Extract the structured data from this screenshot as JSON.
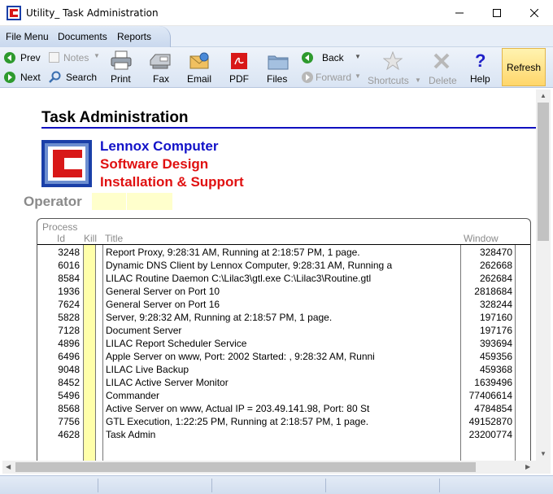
{
  "window": {
    "title": "Utility_ Task Administration"
  },
  "menu": {
    "items": [
      "File Menu",
      "Documents",
      "Reports"
    ]
  },
  "toolbar": {
    "prev": "Prev",
    "next": "Next",
    "notes": "Notes",
    "search": "Search",
    "print": "Print",
    "fax": "Fax",
    "email": "Email",
    "pdf": "PDF",
    "files": "Files",
    "back": "Back",
    "forward": "Forward",
    "shortcuts": "Shortcuts",
    "delete": "Delete",
    "help": "Help",
    "refresh": "Refresh"
  },
  "page": {
    "title": "Task Administration",
    "company": [
      "Lennox Computer",
      "Software Design",
      "Installation & Support"
    ],
    "operator_label": "Operator"
  },
  "grid": {
    "header_process": "Process",
    "header_id": "Id",
    "header_kill": "Kill",
    "header_title": "Title",
    "header_window": "Window",
    "rows": [
      {
        "id": "3248",
        "title": "Report Proxy, 9:28:31 AM, Running at 2:18:57 PM, 1 page.",
        "window": "328470"
      },
      {
        "id": "6016",
        "title": "Dynamic DNS Client by Lennox Computer, 9:28:31 AM, Running a",
        "window": "262668"
      },
      {
        "id": "8584",
        "title": "LILAC Routine Daemon C:\\Lilac3\\gtl.exe C:\\Lilac3\\Routine.gtl",
        "window": "262684"
      },
      {
        "id": "1936",
        "title": "General Server on Port 10",
        "window": "2818684"
      },
      {
        "id": "7624",
        "title": "General Server on Port 16",
        "window": "328244"
      },
      {
        "id": "5828",
        "title": "Server, 9:28:32 AM, Running at 2:18:57 PM, 1 page.",
        "window": "197160"
      },
      {
        "id": "7128",
        "title": "Document Server",
        "window": "197176"
      },
      {
        "id": "4896",
        "title": "LILAC Report Scheduler Service",
        "window": "393694"
      },
      {
        "id": "6496",
        "title": "Apple Server on www, Port: 2002 Started: , 9:28:32 AM, Runni",
        "window": "459356"
      },
      {
        "id": "9048",
        "title": "LILAC Live Backup",
        "window": "459368"
      },
      {
        "id": "8452",
        "title": "LILAC Active Server Monitor",
        "window": "1639496"
      },
      {
        "id": "5496",
        "title": "Commander",
        "window": "77406614"
      },
      {
        "id": "8568",
        "title": "Active Server on www, Actual IP = 203.49.141.98, Port: 80 St",
        "window": "4784854"
      },
      {
        "id": "7756",
        "title": "GTL Execution, 1:22:25 PM, Running at 2:18:57 PM, 1 page.",
        "window": "49152870"
      },
      {
        "id": "4628",
        "title": "Task Admin",
        "window": "23200774"
      }
    ]
  },
  "icons": {
    "prev": "arrow-left-circle-icon",
    "next": "arrow-right-circle-icon",
    "print": "printer-icon",
    "fax": "fax-icon",
    "email": "envelope-icon",
    "pdf": "pdf-icon",
    "files": "folder-icon",
    "shortcuts": "star-icon",
    "delete": "x-icon",
    "help": "question-icon"
  }
}
